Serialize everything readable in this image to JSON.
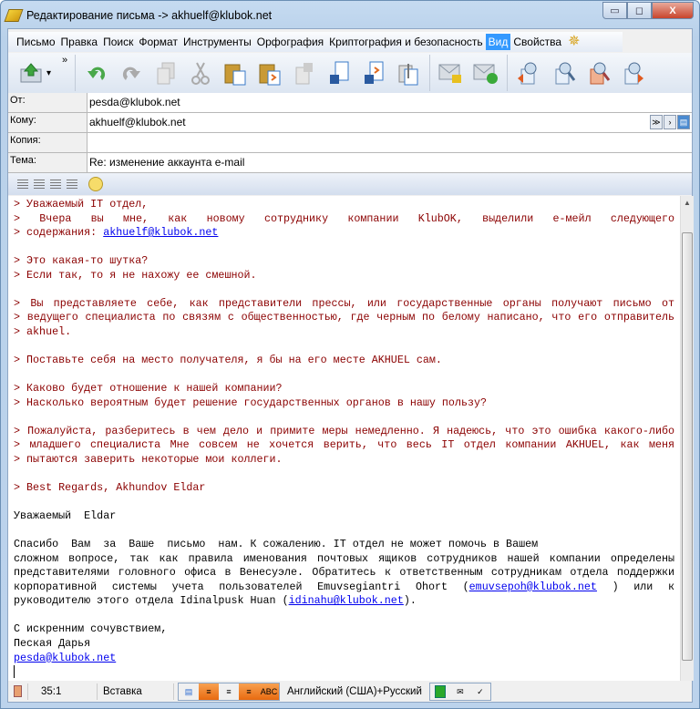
{
  "window": {
    "title": "Редактирование письма -> akhuelf@klubok.net",
    "min": "▭",
    "max": "◻",
    "close": "X"
  },
  "menu": [
    "Письмо",
    "Правка",
    "Поиск",
    "Формат",
    "Инструменты",
    "Орфография",
    "Криптография и безопасность",
    "Вид",
    "Свойства"
  ],
  "toolbar": {
    "overflow": "»",
    "send_dropdown": "▾"
  },
  "header": {
    "from_label": "От:",
    "from": "pesda@klubok.net",
    "to_label": "Кому:",
    "to": "akhuelf@klubok.net",
    "cc_label": "Копия:",
    "cc": "",
    "subject_label": "Тема:",
    "subject": "Re: изменение аккаунта e-mail"
  },
  "body": {
    "lines": [
      {
        "c": "q",
        "t": "> Уважаемый IT отдел,"
      },
      {
        "c": "q j",
        "t": "> Вчера вы мне, как новому сотруднику компании KlubOK, выделили е-мейл следующего"
      },
      {
        "c": "q",
        "t": "> содержания: ",
        "link": "akhuelf@klubok.net"
      },
      {
        "c": "",
        "t": ""
      },
      {
        "c": "q",
        "t": "> Это какая-то шутка?"
      },
      {
        "c": "q",
        "t": "> Если так, то я не нахожу ее смешной."
      },
      {
        "c": "",
        "t": ""
      },
      {
        "c": "q j",
        "t": "> Вы представляете себе, как представители прессы, или государственные органы получают письмо от"
      },
      {
        "c": "q j",
        "t": "> ведущего специалиста по связям с общественностью, где черным по белому написано, что его отправитель"
      },
      {
        "c": "q",
        "t": "> akhuel."
      },
      {
        "c": "",
        "t": ""
      },
      {
        "c": "q",
        "t": "> Поставьте себя на место получателя, я бы на его месте AKHUEL сам."
      },
      {
        "c": "",
        "t": ""
      },
      {
        "c": "q",
        "t": "> Каково будет отношение к нашей компании?"
      },
      {
        "c": "q",
        "t": "> Насколько вероятным будет решение государственных органов в нашу пользу?"
      },
      {
        "c": "",
        "t": ""
      },
      {
        "c": "q j",
        "t": "> Пожалуйста, разберитесь в чем дело и примите меры немедленно. Я надеюсь, что это ошибка какого-либо"
      },
      {
        "c": "q j",
        "t": "> младшего специалиста Мне совсем не хочется верить, что весь IT отдел компании AKHUEL, как меня"
      },
      {
        "c": "q",
        "t": "> пытаются заверить некоторые мои коллеги."
      },
      {
        "c": "",
        "t": ""
      },
      {
        "c": "q",
        "t": "> Best Regards, Akhundov Eldar"
      },
      {
        "c": "",
        "t": ""
      },
      {
        "c": "",
        "t": "Уважаемый  Eldar"
      },
      {
        "c": "",
        "t": ""
      },
      {
        "c": "",
        "t": "Спасибо  Вам  за  Ваше  письмо  нам. К сожалению. IT отдел не может помочь в Вашем"
      },
      {
        "c": "j",
        "t": "сложном вопросе, так как правила именования почтовых ящиков сотрудников нашей компании определены"
      },
      {
        "c": "j",
        "t": "представителями головного офиса в Венесуэле. Обратитесь к ответственным сотрудникам отдела поддержки"
      },
      {
        "c": "j",
        "t": "корпоративной системы учета пользователей Emuvsegiantri Ohort (",
        "link": "emuvsepoh@klubok.net",
        "after": ") или к"
      },
      {
        "c": "",
        "t": "руководителю этого отдела Idinalpusk Huan (",
        "link": "idinahu@klubok.net",
        "after": ")."
      },
      {
        "c": "",
        "t": ""
      },
      {
        "c": "",
        "t": "С искренним сочувствием,"
      },
      {
        "c": "",
        "t": "Пеская Дарья"
      },
      {
        "c": "",
        "t": "",
        "link": "pesda@klubok.net"
      }
    ]
  },
  "status": {
    "position": "35:1",
    "mode": "Вставка",
    "language": "Английский (США)+Русский"
  }
}
